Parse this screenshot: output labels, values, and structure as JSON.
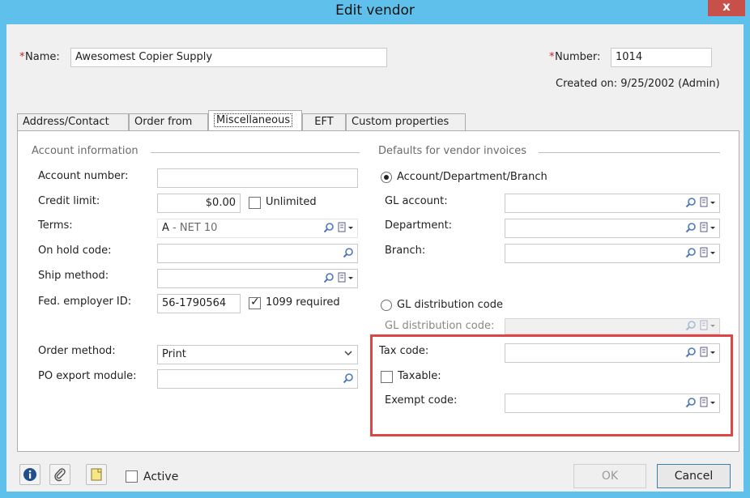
{
  "window": {
    "title": "Edit vendor",
    "close": "x"
  },
  "header": {
    "name_req": "*",
    "name_label": "Name:",
    "name_value": "Awesomest Copier Supply",
    "number_req": "*",
    "number_label": "Number:",
    "number_value": "1014",
    "created_on": "Created on: 9/25/2002 (Admin)"
  },
  "tabs": [
    {
      "label": "Address/Contact"
    },
    {
      "label": "Order from"
    },
    {
      "label": "Miscellaneous"
    },
    {
      "label": "EFT"
    },
    {
      "label": "Custom properties"
    }
  ],
  "account": {
    "group": "Account information",
    "account_number_label": "Account number:",
    "account_number_value": "",
    "credit_limit_label": "Credit limit:",
    "credit_limit_value": "$0.00",
    "unlimited_label": "Unlimited",
    "terms_label": "Terms:",
    "terms_code": "A",
    "terms_desc": " - NET 10",
    "on_hold_label": "On hold code:",
    "ship_method_label": "Ship method:",
    "fed_id_label": "Fed. employer ID:",
    "fed_id_value": "56-1790564",
    "req1099_label": "1099 required",
    "order_method_label": "Order method:",
    "order_method_value": "Print",
    "po_export_label": "PO export module:"
  },
  "defaults": {
    "group": "Defaults for vendor invoices",
    "radio_adb": "Account/Department/Branch",
    "gl_account_label": "GL account:",
    "department_label": "Department:",
    "branch_label": "Branch:",
    "radio_gldist": "GL distribution code",
    "gl_dist_label": "GL distribution code:",
    "tax_code_label": "Tax code:",
    "taxable_label": "Taxable:",
    "exempt_code_label": "Exempt code:"
  },
  "footer": {
    "active_label": "Active",
    "ok_label": "OK",
    "cancel_label": "Cancel"
  },
  "colors": {
    "titlebar": "#5fc0ec",
    "close": "#c7504b",
    "highlight": "#e04545",
    "required": "#d02020"
  }
}
